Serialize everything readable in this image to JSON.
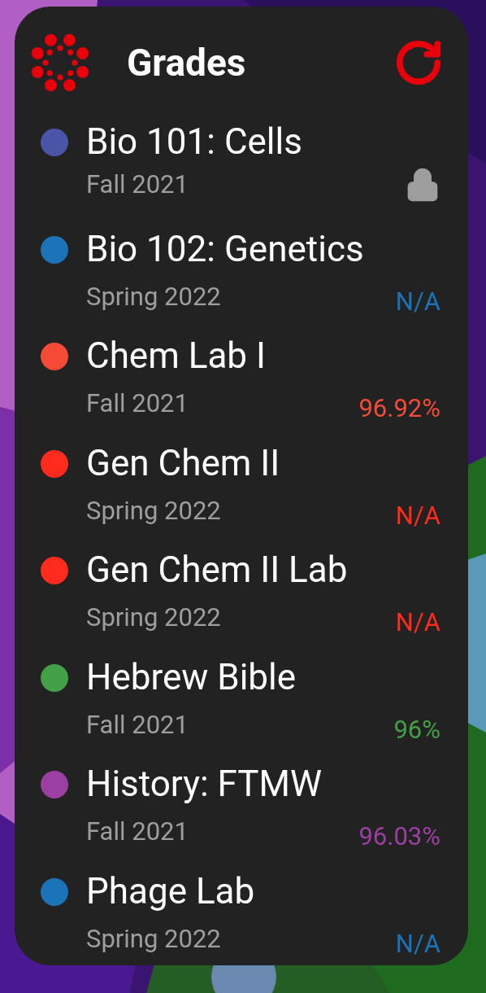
{
  "widget": {
    "title": "Grades"
  },
  "courses": [
    {
      "name": "Bio 101: Cells",
      "term": "Fall 2021",
      "color": "#4b55a8",
      "kind": "locked"
    },
    {
      "name": "Bio 102: Genetics",
      "term": "Spring 2022",
      "color": "#1c74b8",
      "kind": "grade",
      "grade": "N/A"
    },
    {
      "name": "Chem Lab I",
      "term": "Fall 2021",
      "color": "#f44a36",
      "kind": "grade",
      "grade": "96.92%"
    },
    {
      "name": "Gen Chem II",
      "term": "Spring 2022",
      "color": "#ff2b1c",
      "kind": "grade",
      "grade": "N/A"
    },
    {
      "name": "Gen Chem II Lab",
      "term": "Spring 2022",
      "color": "#ff2b1c",
      "kind": "grade",
      "grade": "N/A"
    },
    {
      "name": "Hebrew Bible",
      "term": "Fall 2021",
      "color": "#43a047",
      "kind": "grade",
      "grade": "96%"
    },
    {
      "name": "History: FTMW",
      "term": "Fall 2021",
      "color": "#9c3fa3",
      "kind": "grade",
      "grade": "96.03%"
    },
    {
      "name": "Phage Lab",
      "term": "Spring 2022",
      "color": "#1c74b8",
      "kind": "grade",
      "grade": "N/A"
    }
  ]
}
